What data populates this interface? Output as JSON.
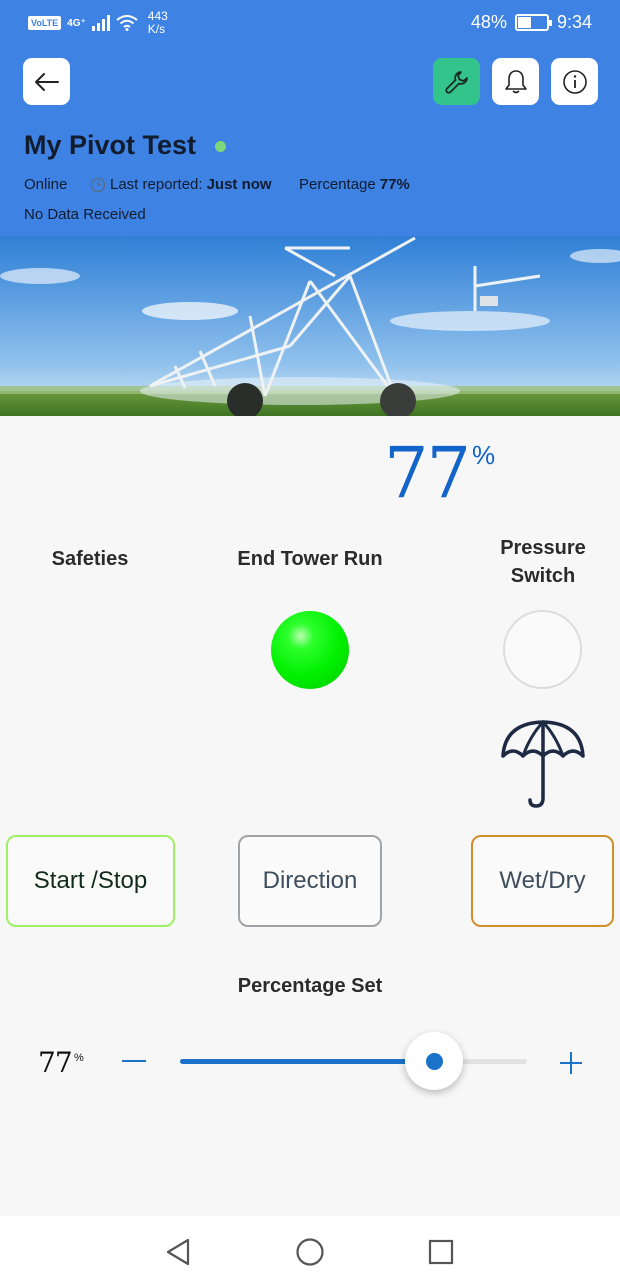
{
  "status_bar": {
    "network_badge": "VoLTE",
    "signal_label": "4G⁺",
    "speed_value": "443",
    "speed_unit": "K/s",
    "battery": "48%",
    "time": "9:34",
    "battery_level": 0.48
  },
  "header": {
    "title": "My Pivot Test",
    "status": "Online",
    "last_reported_label": "Last reported:",
    "last_reported_value": "Just now",
    "percentage_label": "Percentage",
    "percentage_value": "77%",
    "data_status": "No Data Received",
    "buttons": {
      "back": "back-arrow-icon",
      "settings": "wrench-icon",
      "notifications": "bell-icon",
      "info": "info-icon"
    },
    "colors": {
      "header_bg": "#3e82e4",
      "settings_btn": "#33c48c",
      "online_dot": "#7ed67a"
    }
  },
  "hero": {
    "image": "center-pivot-irrigation-photo"
  },
  "main": {
    "big_percentage": "77",
    "big_percentage_sign": "%",
    "indicators": {
      "safeties": {
        "label": "Safeties"
      },
      "end_tower_run": {
        "label": "End Tower Run",
        "state": "on",
        "color": "#00f000"
      },
      "pressure_switch": {
        "label_line1": "Pressure",
        "label_line2": "Switch",
        "state": "off"
      }
    },
    "wet_dry_icon": "umbrella-icon",
    "controls": {
      "start_stop": "Start /Stop",
      "direction": "Direction",
      "wet_dry": "Wet/Dry"
    },
    "control_colors": {
      "start_stop": "#9ef065",
      "direction": "#9ea4a8",
      "wet_dry": "#d08e2c"
    }
  },
  "percentage_set": {
    "label": "Percentage Set",
    "value_text": "77",
    "value_sign": "%",
    "slider_value": 77,
    "slider_min": 0,
    "slider_max": 100,
    "minus_icon": "minus-icon",
    "plus_icon": "plus-icon"
  },
  "nav_bar": {
    "back": "nav-back-icon",
    "home": "nav-home-icon",
    "recents": "nav-recents-icon"
  }
}
